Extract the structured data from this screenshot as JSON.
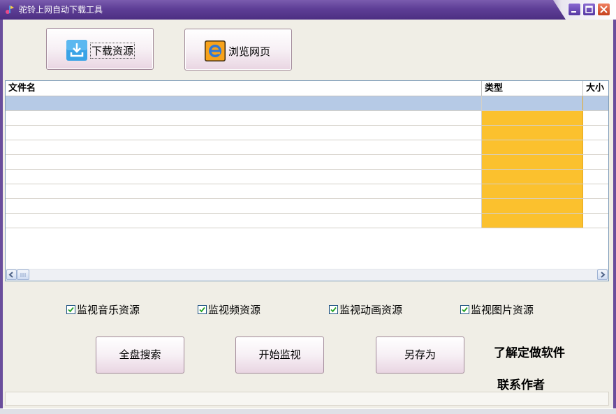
{
  "window": {
    "title": "驼铃上网自动下载工具",
    "icon": "app-logo-icon",
    "controls": [
      "minimize-icon",
      "maximize-icon",
      "close-icon"
    ]
  },
  "toolbar": {
    "download_label": "下载资源",
    "download_icon": "download-icon",
    "browse_label": "浏览网页",
    "browse_icon": "ie-browser-icon"
  },
  "list": {
    "columns": [
      {
        "label": "文件名"
      },
      {
        "label": "类型"
      },
      {
        "label": "大小"
      }
    ],
    "rows": [
      {
        "name": "",
        "type": "",
        "size": "",
        "selected": true
      },
      {
        "name": "",
        "type": "",
        "size": ""
      },
      {
        "name": "",
        "type": "",
        "size": ""
      },
      {
        "name": "",
        "type": "",
        "size": ""
      },
      {
        "name": "",
        "type": "",
        "size": ""
      },
      {
        "name": "",
        "type": "",
        "size": ""
      },
      {
        "name": "",
        "type": "",
        "size": ""
      },
      {
        "name": "",
        "type": "",
        "size": ""
      },
      {
        "name": "",
        "type": "",
        "size": ""
      }
    ],
    "type_column_color": "#fbc12e",
    "selected_row_color": "#b6cae6"
  },
  "monitor": {
    "music": {
      "label": "监视音乐资源",
      "checked": true
    },
    "video": {
      "label": "监视频资源",
      "checked": true
    },
    "animation": {
      "label": "监视动画资源",
      "checked": true
    },
    "image": {
      "label": "监视图片资源",
      "checked": true
    }
  },
  "actions": {
    "search_all": "全盘搜索",
    "start_monitor": "开始监视",
    "save_as": "另存为"
  },
  "side": {
    "custom_software": "了解定做软件",
    "contact_author": "联系作者"
  },
  "theme": {
    "titlebar": "#5e3e96",
    "accent": "#fbc12e"
  }
}
